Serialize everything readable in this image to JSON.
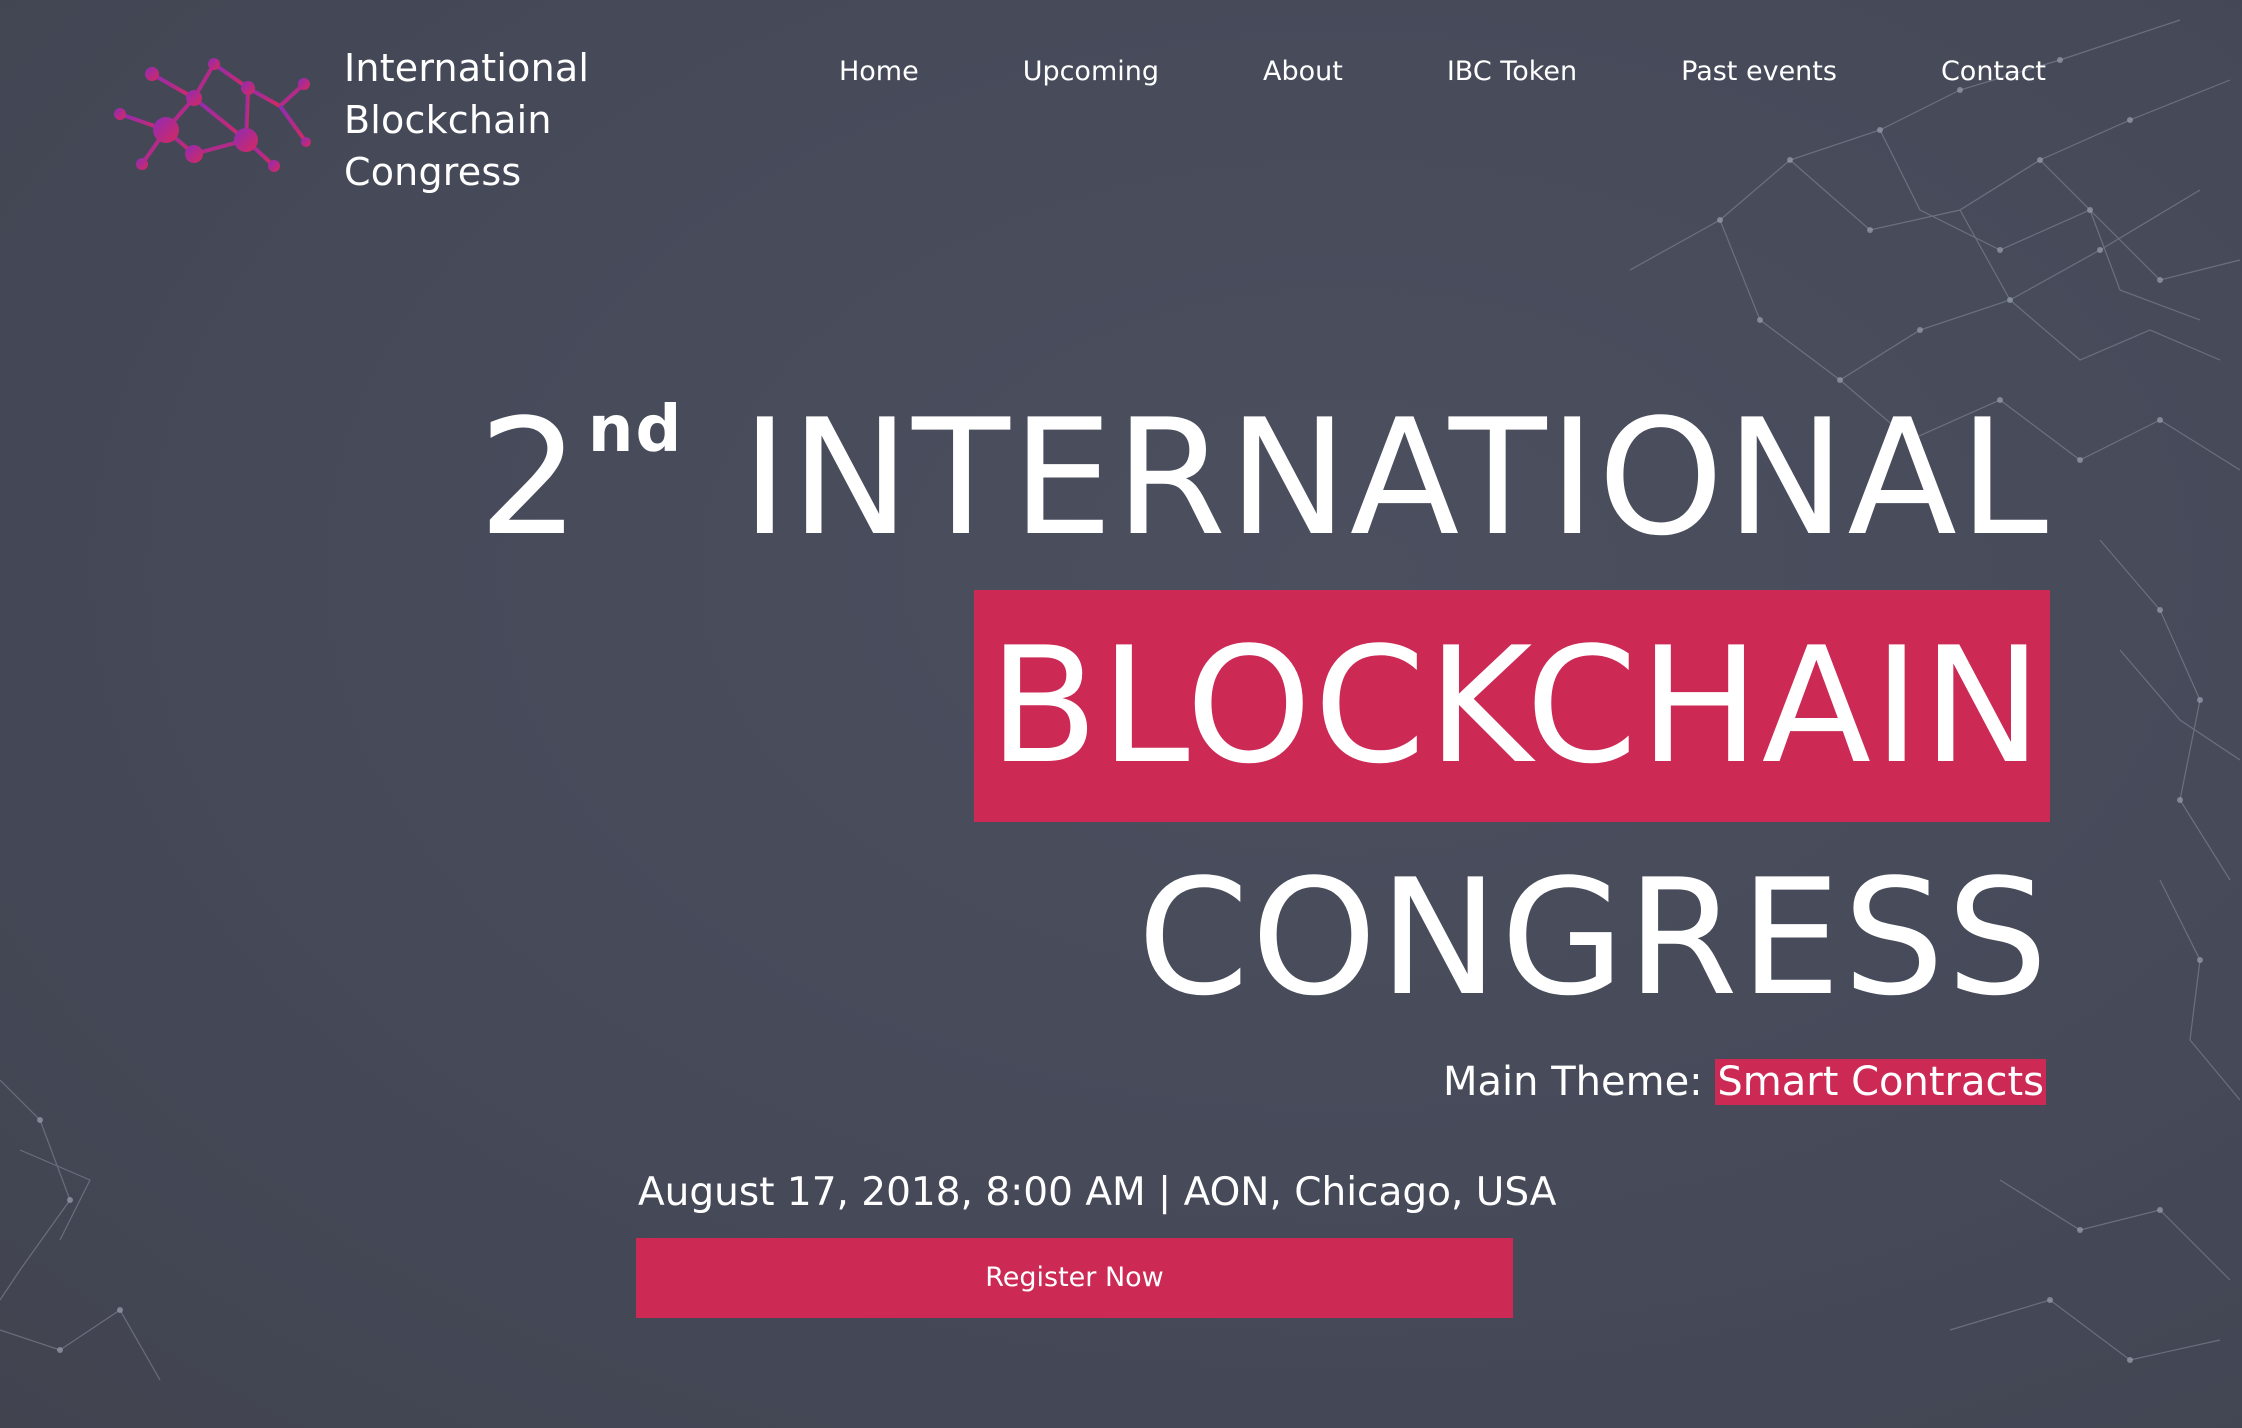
{
  "brand": {
    "line1": "International",
    "line2": "Blockchain",
    "line3": "Congress",
    "logo_icon": "network-nodes-logo"
  },
  "nav": {
    "items": [
      {
        "label": "Home"
      },
      {
        "label": "Upcoming"
      },
      {
        "label": "About"
      },
      {
        "label": "IBC Token"
      },
      {
        "label": "Past events"
      },
      {
        "label": "Contact"
      }
    ]
  },
  "hero": {
    "ordinal_number": "2",
    "ordinal_suffix": "nd",
    "line1": "INTERNATIONAL",
    "line2": "BLOCKCHAIN",
    "line3": "CONGRESS",
    "theme_label": "Main Theme: ",
    "theme_value": "Smart Contracts",
    "event_info": "August 17, 2018, 8:00 AM | AON, Chicago, USA",
    "register_label": "Register Now"
  },
  "colors": {
    "background": "#474b5a",
    "accent": "#cc2955",
    "text": "#ffffff",
    "logo_gradient_start": "#8e2bb8",
    "logo_gradient_end": "#d62a5c"
  }
}
